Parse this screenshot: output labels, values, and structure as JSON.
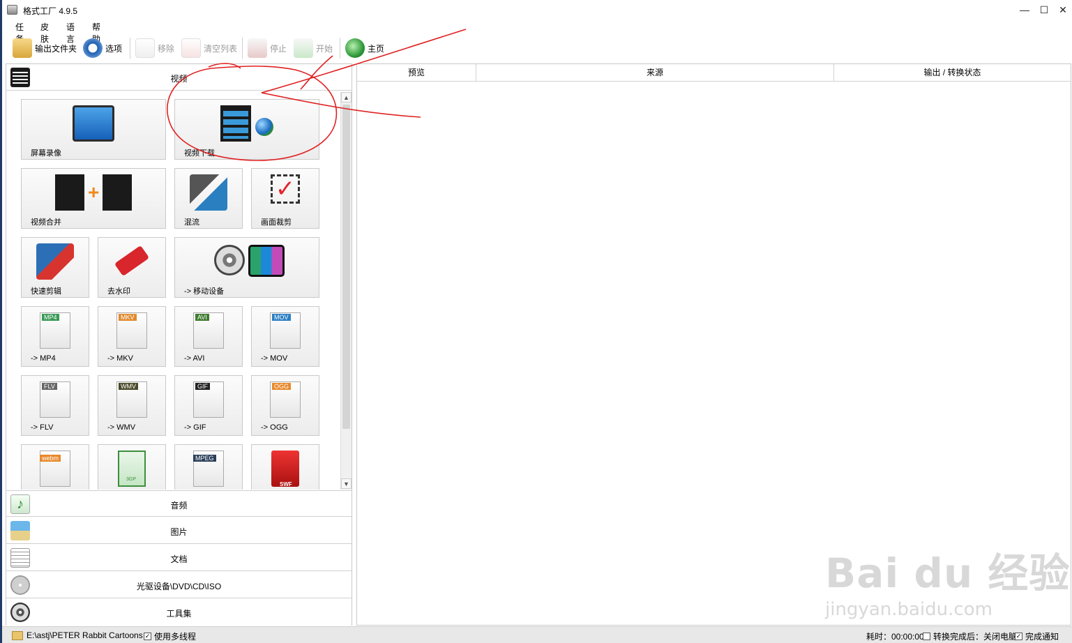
{
  "window": {
    "title": "格式工厂 4.9.5",
    "minimize": "—",
    "maximize": "☐",
    "close": "✕"
  },
  "menu": [
    "任务",
    "皮肤",
    "语言",
    "帮助"
  ],
  "toolbar": {
    "output_folder": "输出文件夹",
    "options": "选项",
    "remove": "移除",
    "clear_list": "清空列表",
    "stop": "停止",
    "start": "开始",
    "home": "主页"
  },
  "categories": {
    "video": "视频",
    "audio": "音频",
    "picture": "图片",
    "document": "文档",
    "disc": "光驱设备\\DVD\\CD\\ISO",
    "tools": "工具集"
  },
  "tiles": {
    "screen_record": "屏幕录像",
    "video_download": "视频下载",
    "video_merge": "视频合并",
    "mux": "混流",
    "crop": "画面裁剪",
    "quick_clip": "快速剪辑",
    "remove_watermark": "去水印",
    "mobile": "-> 移动设备",
    "mp4": "-> MP4",
    "mkv": "-> MKV",
    "avi": "-> AVI",
    "mov": "-> MOV",
    "flv": "-> FLV",
    "wmv": "-> WMV",
    "gif": "-> GIF",
    "ogg": "-> OGG"
  },
  "icon_badges": {
    "mp4": "MP4",
    "mkv": "MKV",
    "avi": "AVI",
    "mov": "MOV",
    "flv": "FLV",
    "wmv": "WMV",
    "gif": "GIF",
    "ogg": "OGG",
    "webm": "webm",
    "3gp": "3GP",
    "mpeg": "MPEG",
    "swf": "SWF"
  },
  "table_headers": {
    "preview": "预览",
    "source": "来源",
    "status": "输出 / 转换状态"
  },
  "statusbar": {
    "path": "E:\\astj\\PETER Rabbit Cartoons",
    "multithread": "使用多线程",
    "elapsed": "耗时：00:00:00",
    "after_convert": "转换完成后：关闭电脑",
    "notify": "完成通知"
  },
  "watermark": {
    "main": "Bai du 经验",
    "sub": "jingyan.baidu.com"
  },
  "colors": {
    "annotation": "#e02020",
    "window_border": "#1f3a66",
    "statusbar": "#e8e8e8"
  }
}
